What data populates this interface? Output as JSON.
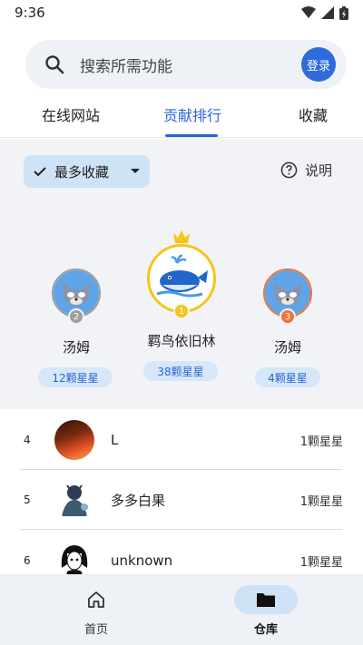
{
  "status_bar": {
    "time": "9:36"
  },
  "search": {
    "placeholder": "搜索所需功能",
    "login_label": "登录"
  },
  "tabs": [
    {
      "label": "在线网站",
      "active": false
    },
    {
      "label": "贡献排行",
      "active": true
    },
    {
      "label": "收藏",
      "active": false
    }
  ],
  "sort": {
    "label": "最多收藏"
  },
  "explain": {
    "label": "说明"
  },
  "podium": [
    {
      "rank": "2",
      "name": "汤姆",
      "stars": "12颗星星",
      "avatar_icon": "tom-cat-avatar-icon"
    },
    {
      "rank": "1",
      "name": "羁鸟依旧林",
      "stars": "38颗星星",
      "avatar_icon": "whale-avatar-icon"
    },
    {
      "rank": "3",
      "name": "汤姆",
      "stars": "4颗星星",
      "avatar_icon": "tom-cat-avatar-icon"
    }
  ],
  "list": [
    {
      "rank": "4",
      "name": "L",
      "stars": "1颗星星"
    },
    {
      "rank": "5",
      "name": "多多白果",
      "stars": "1颗星星"
    },
    {
      "rank": "6",
      "name": "unknown",
      "stars": "1颗星星"
    }
  ],
  "bottom_nav": [
    {
      "label": "首页",
      "icon": "home-icon",
      "active": false
    },
    {
      "label": "仓库",
      "icon": "folder-icon",
      "active": true
    }
  ],
  "colors": {
    "accent": "#2a65d8",
    "chip_bg": "#cfe3f7",
    "gold": "#f5c518",
    "silver": "#9e9e9e",
    "bronze": "#f0733a"
  }
}
